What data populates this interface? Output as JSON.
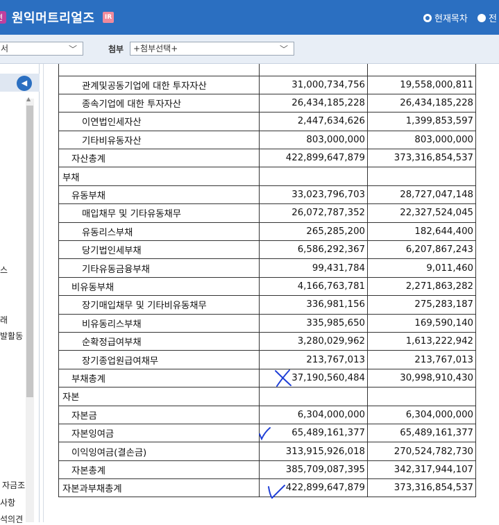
{
  "header": {
    "left_badge": "편",
    "company": "원익머트리얼즈",
    "ir_badge": "IR",
    "radio_current": "현재목차",
    "radio_all": "전"
  },
  "toolbar": {
    "doc_select_value": "서",
    "attach_label": "첨부",
    "attach_select_value": "+첨부선택+"
  },
  "sidebar": {
    "fragments": [
      "스",
      "래",
      "발활동",
      "자금조",
      "사항",
      "석의견"
    ]
  },
  "table": {
    "rows": [
      {
        "label": "",
        "v1": "",
        "v2": ""
      },
      {
        "label": "관계및공동기업에 대한 투자자산",
        "v1": "31,000,734,756",
        "v2": "19,558,000,811"
      },
      {
        "label": "종속기업에 대한 투자자산",
        "v1": "26,434,185,228",
        "v2": "26,434,185,228"
      },
      {
        "label": "이연법인세자산",
        "v1": "2,447,634,626",
        "v2": "1,399,853,597"
      },
      {
        "label": "기타비유동자산",
        "v1": "803,000,000",
        "v2": "803,000,000"
      },
      {
        "label": "자산총계",
        "v1": "422,899,647,879",
        "v2": "373,316,854,537"
      },
      {
        "label": "부채",
        "v1": "",
        "v2": ""
      },
      {
        "label": "유동부채",
        "v1": "33,023,796,703",
        "v2": "28,727,047,148"
      },
      {
        "label": "매입채무 및 기타유동채무",
        "v1": "26,072,787,352",
        "v2": "22,327,524,045"
      },
      {
        "label": "유동리스부채",
        "v1": "265,285,200",
        "v2": "182,644,400"
      },
      {
        "label": "당기법인세부채",
        "v1": "6,586,292,367",
        "v2": "6,207,867,243"
      },
      {
        "label": "기타유동금융부채",
        "v1": "99,431,784",
        "v2": "9,011,460"
      },
      {
        "label": "비유동부채",
        "v1": "4,166,763,781",
        "v2": "2,271,863,282"
      },
      {
        "label": "장기매입채무 및 기타비유동채무",
        "v1": "336,981,156",
        "v2": "275,283,187"
      },
      {
        "label": "비유동리스부채",
        "v1": "335,985,650",
        "v2": "169,590,140"
      },
      {
        "label": "순확정급여부채",
        "v1": "3,280,029,962",
        "v2": "1,613,222,942"
      },
      {
        "label": "장기종업원급여채무",
        "v1": "213,767,013",
        "v2": "213,767,013"
      },
      {
        "label": "부채총계",
        "v1": "37,190,560,484",
        "v2": "30,998,910,430"
      },
      {
        "label": "자본",
        "v1": "",
        "v2": ""
      },
      {
        "label": "자본금",
        "v1": "6,304,000,000",
        "v2": "6,304,000,000"
      },
      {
        "label": "자본잉여금",
        "v1": "65,489,161,377",
        "v2": "65,489,161,377"
      },
      {
        "label": "이익잉여금(결손금)",
        "v1": "313,915,926,018",
        "v2": "270,524,782,730"
      },
      {
        "label": "자본총계",
        "v1": "385,709,087,395",
        "v2": "342,317,944,107"
      },
      {
        "label": "자본과부채총계",
        "v1": "422,899,647,879",
        "v2": "373,316,854,537"
      }
    ]
  },
  "annotations": {
    "color": "#1f3fd6",
    "marks": [
      "x-mark",
      "check-mark",
      "check-mark"
    ]
  }
}
